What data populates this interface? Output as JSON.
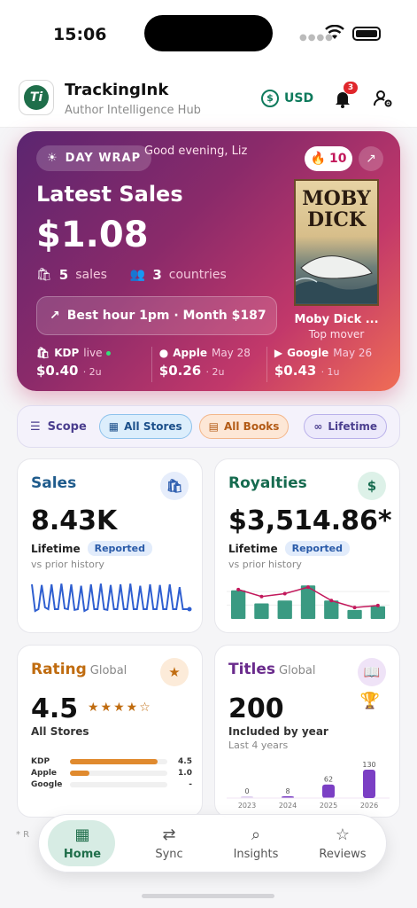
{
  "status": {
    "time": "15:06"
  },
  "app": {
    "title": "TrackingInk",
    "subtitle": "Author Intelligence Hub",
    "logo_text": "Ti",
    "currency": "USD",
    "notifications": "3"
  },
  "hero": {
    "day_wrap": "DAY WRAP",
    "greeting": "Good evening, Liz",
    "streak": "10",
    "title": "Latest Sales",
    "amount": "$1.08",
    "sales_count": "5",
    "sales_label": "sales",
    "countries_count": "3",
    "countries_label": "countries",
    "best_hour": "Best hour 1pm · Month $187",
    "book": {
      "cover_title": "MOBY DICK",
      "name": "Moby Dick ...",
      "subtitle": "Top mover"
    },
    "stores": [
      {
        "name": "KDP",
        "date": "live",
        "amount": "$0.40",
        "units": "· 2u"
      },
      {
        "name": "Apple",
        "date": "May 28",
        "amount": "$0.26",
        "units": "· 2u"
      },
      {
        "name": "Google",
        "date": "May 26",
        "amount": "$0.43",
        "units": "· 1u"
      }
    ]
  },
  "scope": {
    "label": "Scope",
    "stores": "All Stores",
    "books": "All Books",
    "range": "Lifetime"
  },
  "sales_card": {
    "title": "Sales",
    "value": "8.43K",
    "period": "Lifetime",
    "badge": "Reported",
    "note": "vs prior history",
    "chart_data": {
      "type": "line",
      "series": [
        {
          "values": [
            0.9,
            0.15,
            0.2,
            0.88,
            0.25,
            0.2,
            0.9,
            0.2,
            0.2,
            0.92,
            0.22,
            0.2,
            0.9,
            0.18,
            0.2,
            0.86,
            0.15,
            0.2,
            0.9,
            0.2,
            0.2,
            0.92,
            0.2,
            0.18,
            0.88,
            0.2,
            0.2,
            0.9,
            0.2,
            0.2,
            0.92,
            0.2,
            0.2,
            0.86,
            0.2,
            0.2,
            0.9,
            0.2,
            0.2,
            0.88,
            0.2,
            0.2,
            0.9,
            0.2,
            0.2,
            0.82,
            0.2,
            0.2,
            0.2
          ]
        }
      ]
    }
  },
  "royalties_card": {
    "title": "Royalties",
    "value": "$3,514.86*",
    "period": "Lifetime",
    "badge": "Reported",
    "note": "vs prior history",
    "chart_data": {
      "type": "bar",
      "values": [
        0.7,
        0.38,
        0.45,
        0.82,
        0.45,
        0.22,
        0.31
      ],
      "trend": [
        0.72,
        0.55,
        0.62,
        0.78,
        0.45,
        0.28,
        0.33
      ]
    }
  },
  "rating_card": {
    "title": "Rating",
    "scope": "Global",
    "value": "4.5",
    "stars": 4.5,
    "caption": "All Stores",
    "rows": [
      {
        "store": "KDP",
        "value": "4.5",
        "fill": 0.9
      },
      {
        "store": "Apple",
        "value": "1.0",
        "fill": 0.2
      },
      {
        "store": "Google",
        "value": "-",
        "fill": 0
      }
    ]
  },
  "titles_card": {
    "title": "Titles",
    "scope": "Global",
    "value": "200",
    "caption": "Included by year",
    "note": "Last 4 years",
    "chart_data": {
      "type": "bar",
      "categories": [
        "2023",
        "2024",
        "2025",
        "2026"
      ],
      "values": [
        0,
        8,
        62,
        130
      ]
    }
  },
  "tabs": [
    {
      "label": "Home"
    },
    {
      "label": "Sync"
    },
    {
      "label": "Insights"
    },
    {
      "label": "Reviews"
    }
  ],
  "footnote": "* R"
}
